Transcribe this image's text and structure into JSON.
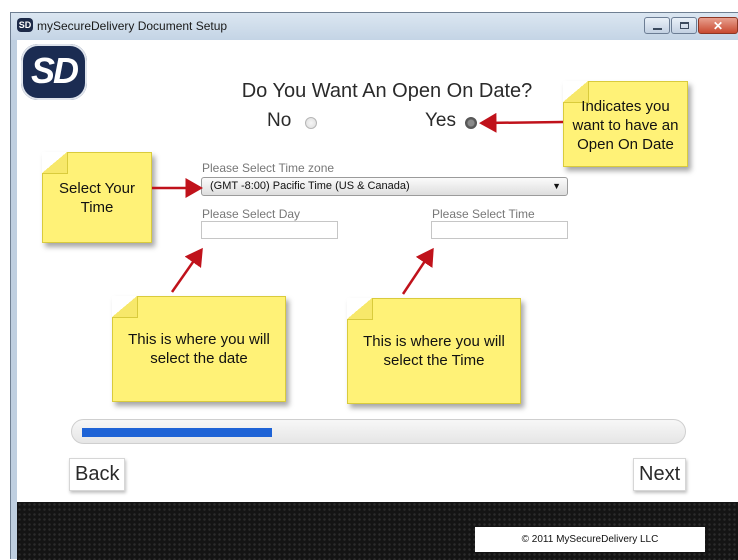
{
  "window": {
    "logo_text": "SD",
    "title": "mySecureDelivery Document Setup",
    "controls": {
      "minimize": "minimize-icon",
      "maximize": "maximize-icon",
      "close": "close-icon",
      "close_glyph": "✕"
    }
  },
  "app": {
    "logo_text": "SD"
  },
  "question": {
    "text": "Do You Want An Open On Date?",
    "options": [
      {
        "label": "No",
        "selected": false
      },
      {
        "label": "Yes",
        "selected": true
      }
    ]
  },
  "timezone": {
    "label": "Please Select Time zone",
    "value": "(GMT -8:00) Pacific Time (US & Canada)"
  },
  "day": {
    "label": "Please Select Day",
    "value": ""
  },
  "time": {
    "label": "Please Select Time",
    "value": ""
  },
  "notes": {
    "open_on_date": "Indicates you want to have an Open On Date",
    "select_time_zone": "Select Your Time",
    "select_date": "This is where you will select the date",
    "select_time": "This is where you will select the Time"
  },
  "progress": {
    "fraction": 0.32
  },
  "nav": {
    "back": "Back",
    "next": "Next"
  },
  "footer": {
    "copyright": "© 2011 MySecureDelivery LLC"
  },
  "colors": {
    "note": "#fff277",
    "arrow": "#c0121b",
    "progress": "#1e63d6",
    "footer": "#141414"
  }
}
